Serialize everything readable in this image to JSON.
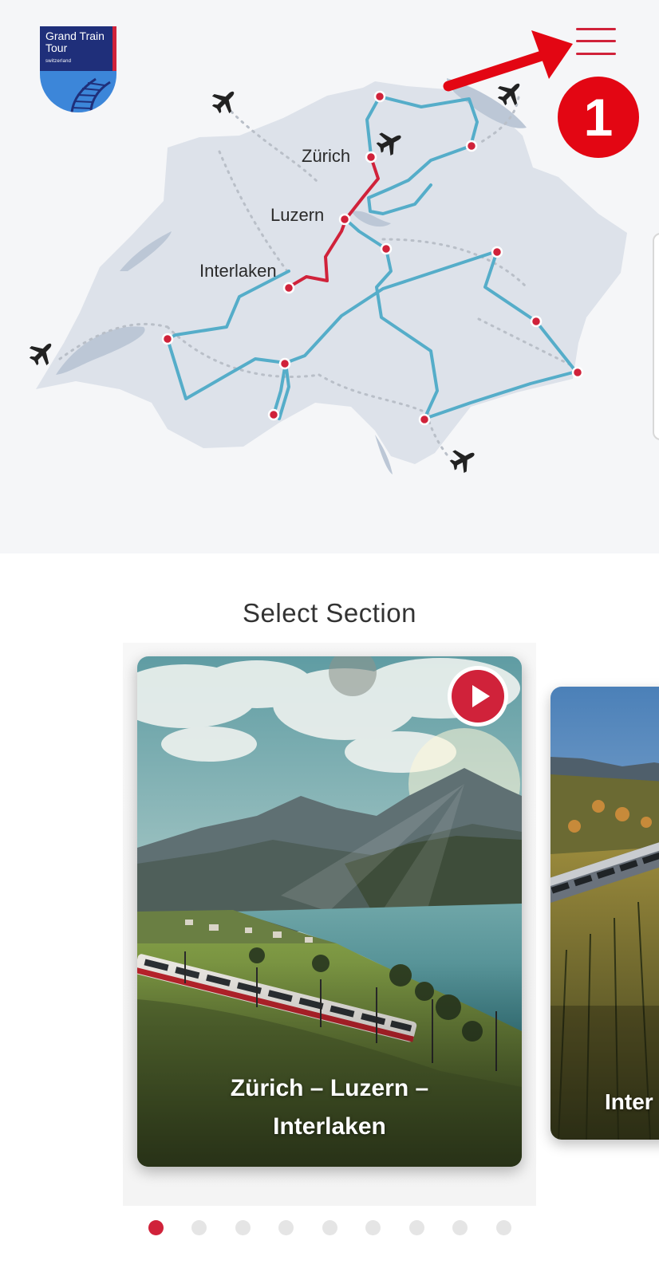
{
  "app": {
    "logo_title": "Grand Train Tour",
    "logo_subtitle": "switzerland"
  },
  "map": {
    "cities": {
      "zurich": "Zürich",
      "luzern": "Luzern",
      "interlaken": "Interlaken"
    },
    "colors": {
      "land": "#dde2ea",
      "route": "#55adc9",
      "highlight_route": "#d0223a",
      "stop": "#d0223a",
      "lake": "#b7c3d4"
    }
  },
  "annotation": {
    "step_number": "1",
    "arrow_color": "#e30613"
  },
  "sections": {
    "title": "Select Section",
    "cards": [
      {
        "label": "Zürich – Luzern – Interlaken"
      },
      {
        "label": "Inter"
      }
    ],
    "pagination": {
      "total": 9,
      "active_index": 0
    }
  },
  "icons": {
    "menu": "hamburger-menu-icon",
    "play": "play-icon",
    "airport": "airplane-icon"
  }
}
